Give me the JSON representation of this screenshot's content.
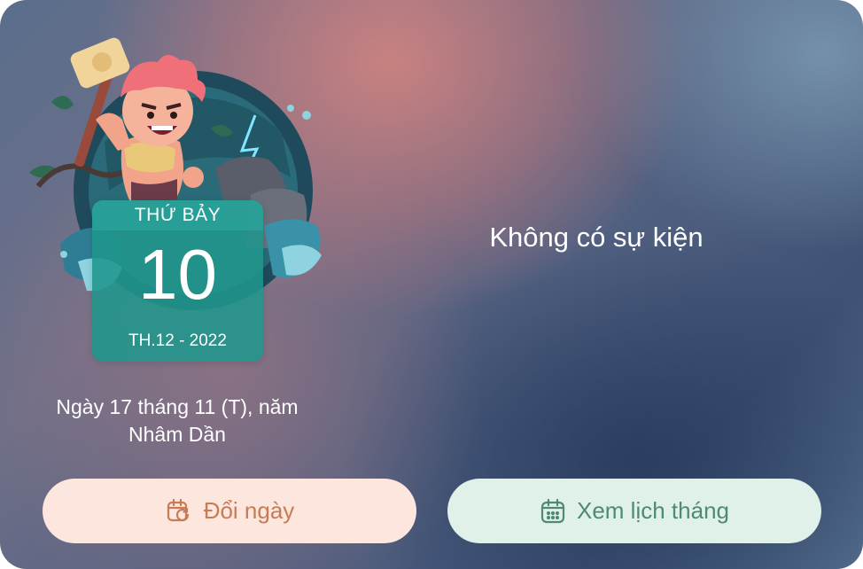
{
  "date_card": {
    "weekday": "THỨ BẢY",
    "day": "10",
    "month_year": "TH.12 - 2022"
  },
  "lunar": {
    "line1": "Ngày 17 tháng 11 (T), năm",
    "line2": "Nhâm Dần"
  },
  "events": {
    "empty_message": "Không có sự kiện"
  },
  "buttons": {
    "change_date_label": "Đổi ngày",
    "change_date_icon": "calendar-refresh-icon",
    "month_view_label": "Xem lịch tháng",
    "month_view_icon": "calendar-icon"
  },
  "colors": {
    "card_teal": "#2aa39a",
    "change_button_bg": "#fde6dd",
    "change_button_text": "#c67d56",
    "month_button_bg": "#dff1e8",
    "month_button_text": "#4f8a72"
  }
}
